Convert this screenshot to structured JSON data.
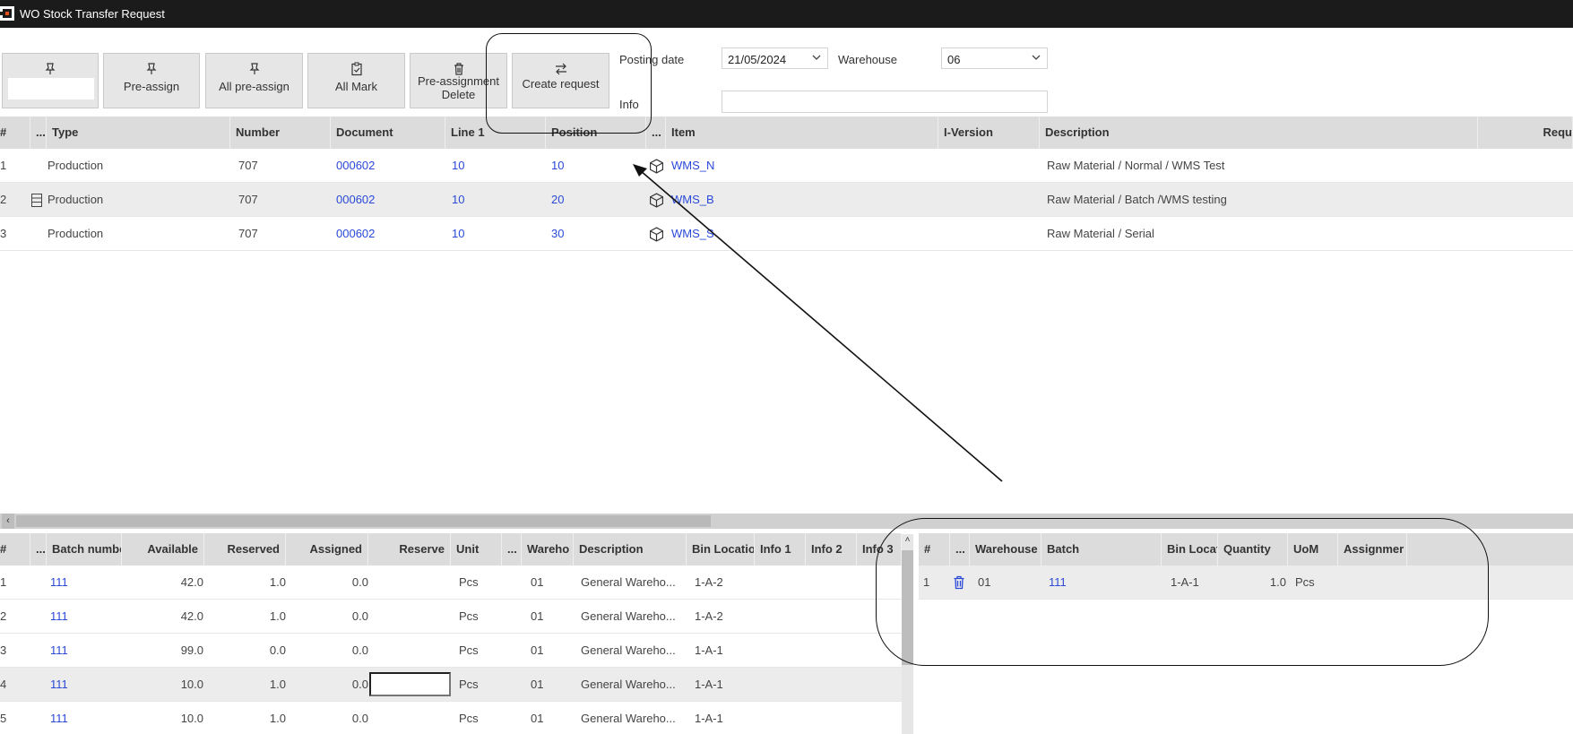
{
  "window": {
    "title": "WO Stock Transfer Request"
  },
  "toolbar": {
    "buttons": [
      {
        "label": "Pre-assign"
      },
      {
        "label": "All pre-assign"
      },
      {
        "label": "All Mark"
      },
      {
        "label_line1": "Pre-assignment",
        "label_line2": "Delete"
      },
      {
        "label": "Create request"
      }
    ]
  },
  "form": {
    "posting_date_label": "Posting date",
    "posting_date_value": "21/05/2024",
    "warehouse_label": "Warehouse",
    "warehouse_value": "06",
    "info_label": "Info",
    "info_value": ""
  },
  "top_grid": {
    "columns": [
      "#",
      "...",
      "Type",
      "Number",
      "Document",
      "Line 1",
      "Position",
      "...",
      "Item",
      "I-Version",
      "Description",
      "Requ"
    ],
    "rows": [
      {
        "num": "1",
        "type": "Production",
        "number": "707",
        "document": "000602",
        "line1": "10",
        "position": "10",
        "item": "WMS_N",
        "description": "Raw Material / Normal / WMS Test",
        "icon": "cube-icon"
      },
      {
        "num": "2",
        "type": "Production",
        "number": "707",
        "document": "000602",
        "line1": "10",
        "position": "20",
        "item": "WMS_B",
        "description": "Raw Material / Batch /WMS testing",
        "icon": "cube-icon"
      },
      {
        "num": "3",
        "type": "Production",
        "number": "707",
        "document": "000602",
        "line1": "10",
        "position": "30",
        "item": "WMS_S",
        "description": "Raw Material / Serial",
        "icon": "cube-icon"
      }
    ]
  },
  "batch_grid": {
    "columns": [
      "#",
      "...",
      "Batch numbe",
      "Available",
      "Reserved",
      "Assigned",
      "Reserve",
      "Unit",
      "...",
      "Wareho",
      "Description",
      "Bin Locatio",
      "Info 1",
      "Info 2",
      "Info 3"
    ],
    "rows": [
      {
        "num": "1",
        "batch": "111",
        "available": "42.0",
        "reserved": "1.0",
        "assigned": "0.0",
        "unit": "Pcs",
        "warehouse": "01",
        "description": "General Wareho...",
        "bin": "1-A-2"
      },
      {
        "num": "2",
        "batch": "111",
        "available": "42.0",
        "reserved": "1.0",
        "assigned": "0.0",
        "unit": "Pcs",
        "warehouse": "01",
        "description": "General Wareho...",
        "bin": "1-A-2"
      },
      {
        "num": "3",
        "batch": "111",
        "available": "99.0",
        "reserved": "0.0",
        "assigned": "0.0",
        "unit": "Pcs",
        "warehouse": "01",
        "description": "General Wareho...",
        "bin": "1-A-1"
      },
      {
        "num": "4",
        "batch": "111",
        "available": "10.0",
        "reserved": "1.0",
        "assigned": "0.0",
        "unit": "Pcs",
        "warehouse": "01",
        "description": "General Wareho...",
        "bin": "1-A-1"
      },
      {
        "num": "5",
        "batch": "111",
        "available": "10.0",
        "reserved": "1.0",
        "assigned": "0.0",
        "unit": "Pcs",
        "warehouse": "01",
        "description": "General Wareho...",
        "bin": "1-A-1"
      }
    ]
  },
  "assign_grid": {
    "columns": [
      "#",
      "...",
      "Warehouse",
      "Batch",
      "Bin Locat",
      "Quantity",
      "UoM",
      "Assignmer"
    ],
    "rows": [
      {
        "num": "1",
        "warehouse": "01",
        "batch": "111",
        "bin": "1-A-1",
        "quantity": "1.0",
        "uom": "Pcs"
      }
    ]
  },
  "colors": {
    "link": "#2a49d8",
    "header_bg": "#dcdcdc",
    "titlebar_bg": "#1b1b1b"
  }
}
